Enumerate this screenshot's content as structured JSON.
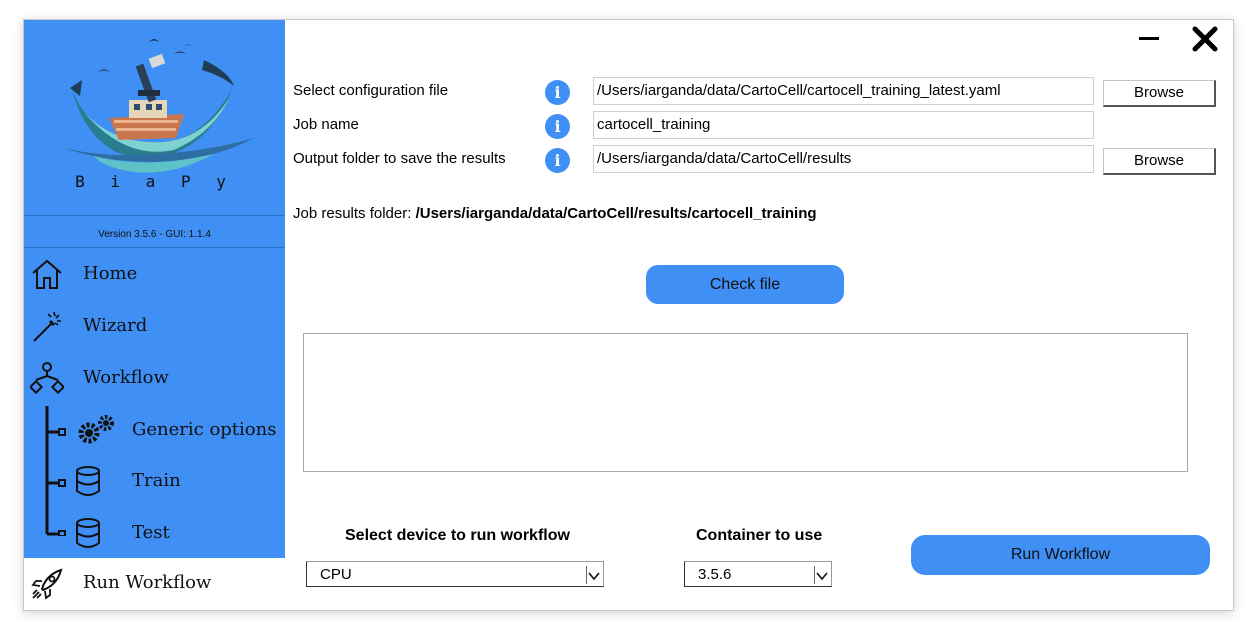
{
  "app": {
    "name": "BiaPy",
    "brand_spaced": "B i a P y",
    "version": "Version 3.5.6 - GUI: 1.1.4"
  },
  "colors": {
    "accent": "#3f8ff5",
    "sidebar_bg": "#3f8ff5",
    "active_item_bg": "#ffffff"
  },
  "sidebar": {
    "items": [
      {
        "label": "Home",
        "icon": "home-icon"
      },
      {
        "label": "Wizard",
        "icon": "magic-wand-icon"
      },
      {
        "label": "Workflow",
        "icon": "workflow-icon"
      },
      {
        "label": "Generic options",
        "icon": "gears-icon"
      },
      {
        "label": "Train",
        "icon": "database-icon"
      },
      {
        "label": "Test",
        "icon": "database-icon"
      },
      {
        "label": "Run Workflow",
        "icon": "rocket-icon",
        "active": true
      }
    ]
  },
  "window_controls": {
    "minimize_icon": "minimize-icon",
    "close_icon": "close-icon"
  },
  "form": {
    "config": {
      "label": "Select configuration file",
      "value": "/Users/iarganda/data/CartoCell/cartocell_training_latest.yaml",
      "browse": "Browse"
    },
    "job_name": {
      "label": "Job name",
      "value": "cartocell_training"
    },
    "output": {
      "label": "Output folder to save the results",
      "value": "/Users/iarganda/data/CartoCell/results",
      "browse": "Browse"
    },
    "info_glyph": "i"
  },
  "results": {
    "label": "Job results folder:",
    "path": "/Users/iarganda/data/CartoCell/results/cartocell_training"
  },
  "check_button": "Check file",
  "device": {
    "label": "Select device to run workflow",
    "selected": "CPU"
  },
  "container": {
    "label": "Container to use",
    "selected": "3.5.6"
  },
  "run_button": "Run Workflow"
}
